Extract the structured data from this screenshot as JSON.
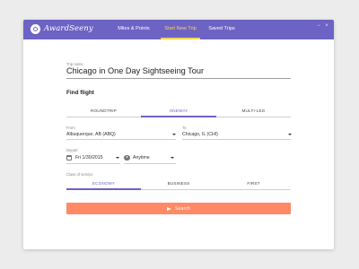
{
  "app": {
    "logo_text": "AwardSeeny",
    "logo_icon": "logo-icon"
  },
  "nav": {
    "items": [
      {
        "label": "Miles & Points",
        "active": false
      },
      {
        "label": "Start New Trip",
        "active": true
      },
      {
        "label": "Saved Trips",
        "active": false
      }
    ]
  },
  "colors": {
    "brand": "#6d63c4",
    "accent": "#ffd54f",
    "search": "#ff8a65"
  },
  "trip": {
    "name_label": "Trip name",
    "name_value": "Chicago in One Day Sightseeing Tour"
  },
  "find_flight": {
    "title": "Find flight",
    "trip_types": [
      {
        "label": "ROUNDTRIP",
        "active": false
      },
      {
        "label": "ONEWAY",
        "active": true
      },
      {
        "label": "MULTI-LEG",
        "active": false
      }
    ],
    "from_label": "From",
    "from_value": "Albuquerque, AB (ABQ)",
    "to_label": "To",
    "to_value": "Chicago, IL (CHI)",
    "depart_label": "Depart",
    "depart_date": "Fri 1/30/2015",
    "depart_time": "Anytime",
    "class_label": "Class of service",
    "classes": [
      {
        "label": "ECONOMY",
        "active": true
      },
      {
        "label": "BUSINESS",
        "active": false
      },
      {
        "label": "FIRST",
        "active": false
      }
    ],
    "search_label": "Search"
  }
}
